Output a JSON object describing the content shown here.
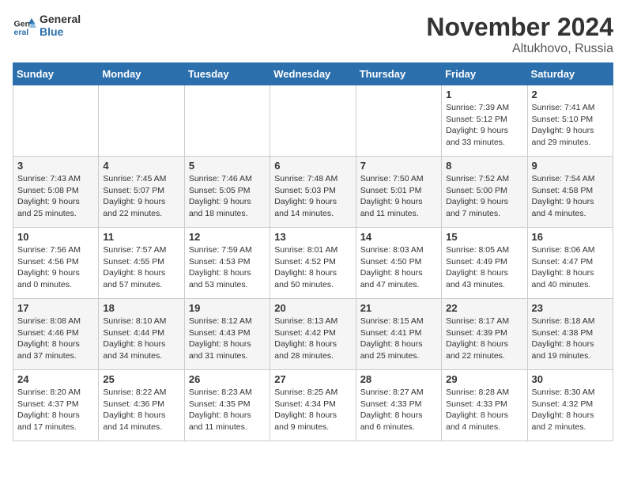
{
  "logo": {
    "line1": "General",
    "line2": "Blue"
  },
  "title": "November 2024",
  "location": "Altukhovo, Russia",
  "days_of_week": [
    "Sunday",
    "Monday",
    "Tuesday",
    "Wednesday",
    "Thursday",
    "Friday",
    "Saturday"
  ],
  "weeks": [
    [
      {
        "day": "",
        "info": ""
      },
      {
        "day": "",
        "info": ""
      },
      {
        "day": "",
        "info": ""
      },
      {
        "day": "",
        "info": ""
      },
      {
        "day": "",
        "info": ""
      },
      {
        "day": "1",
        "info": "Sunrise: 7:39 AM\nSunset: 5:12 PM\nDaylight: 9 hours and 33 minutes."
      },
      {
        "day": "2",
        "info": "Sunrise: 7:41 AM\nSunset: 5:10 PM\nDaylight: 9 hours and 29 minutes."
      }
    ],
    [
      {
        "day": "3",
        "info": "Sunrise: 7:43 AM\nSunset: 5:08 PM\nDaylight: 9 hours and 25 minutes."
      },
      {
        "day": "4",
        "info": "Sunrise: 7:45 AM\nSunset: 5:07 PM\nDaylight: 9 hours and 22 minutes."
      },
      {
        "day": "5",
        "info": "Sunrise: 7:46 AM\nSunset: 5:05 PM\nDaylight: 9 hours and 18 minutes."
      },
      {
        "day": "6",
        "info": "Sunrise: 7:48 AM\nSunset: 5:03 PM\nDaylight: 9 hours and 14 minutes."
      },
      {
        "day": "7",
        "info": "Sunrise: 7:50 AM\nSunset: 5:01 PM\nDaylight: 9 hours and 11 minutes."
      },
      {
        "day": "8",
        "info": "Sunrise: 7:52 AM\nSunset: 5:00 PM\nDaylight: 9 hours and 7 minutes."
      },
      {
        "day": "9",
        "info": "Sunrise: 7:54 AM\nSunset: 4:58 PM\nDaylight: 9 hours and 4 minutes."
      }
    ],
    [
      {
        "day": "10",
        "info": "Sunrise: 7:56 AM\nSunset: 4:56 PM\nDaylight: 9 hours and 0 minutes."
      },
      {
        "day": "11",
        "info": "Sunrise: 7:57 AM\nSunset: 4:55 PM\nDaylight: 8 hours and 57 minutes."
      },
      {
        "day": "12",
        "info": "Sunrise: 7:59 AM\nSunset: 4:53 PM\nDaylight: 8 hours and 53 minutes."
      },
      {
        "day": "13",
        "info": "Sunrise: 8:01 AM\nSunset: 4:52 PM\nDaylight: 8 hours and 50 minutes."
      },
      {
        "day": "14",
        "info": "Sunrise: 8:03 AM\nSunset: 4:50 PM\nDaylight: 8 hours and 47 minutes."
      },
      {
        "day": "15",
        "info": "Sunrise: 8:05 AM\nSunset: 4:49 PM\nDaylight: 8 hours and 43 minutes."
      },
      {
        "day": "16",
        "info": "Sunrise: 8:06 AM\nSunset: 4:47 PM\nDaylight: 8 hours and 40 minutes."
      }
    ],
    [
      {
        "day": "17",
        "info": "Sunrise: 8:08 AM\nSunset: 4:46 PM\nDaylight: 8 hours and 37 minutes."
      },
      {
        "day": "18",
        "info": "Sunrise: 8:10 AM\nSunset: 4:44 PM\nDaylight: 8 hours and 34 minutes."
      },
      {
        "day": "19",
        "info": "Sunrise: 8:12 AM\nSunset: 4:43 PM\nDaylight: 8 hours and 31 minutes."
      },
      {
        "day": "20",
        "info": "Sunrise: 8:13 AM\nSunset: 4:42 PM\nDaylight: 8 hours and 28 minutes."
      },
      {
        "day": "21",
        "info": "Sunrise: 8:15 AM\nSunset: 4:41 PM\nDaylight: 8 hours and 25 minutes."
      },
      {
        "day": "22",
        "info": "Sunrise: 8:17 AM\nSunset: 4:39 PM\nDaylight: 8 hours and 22 minutes."
      },
      {
        "day": "23",
        "info": "Sunrise: 8:18 AM\nSunset: 4:38 PM\nDaylight: 8 hours and 19 minutes."
      }
    ],
    [
      {
        "day": "24",
        "info": "Sunrise: 8:20 AM\nSunset: 4:37 PM\nDaylight: 8 hours and 17 minutes."
      },
      {
        "day": "25",
        "info": "Sunrise: 8:22 AM\nSunset: 4:36 PM\nDaylight: 8 hours and 14 minutes."
      },
      {
        "day": "26",
        "info": "Sunrise: 8:23 AM\nSunset: 4:35 PM\nDaylight: 8 hours and 11 minutes."
      },
      {
        "day": "27",
        "info": "Sunrise: 8:25 AM\nSunset: 4:34 PM\nDaylight: 8 hours and 9 minutes."
      },
      {
        "day": "28",
        "info": "Sunrise: 8:27 AM\nSunset: 4:33 PM\nDaylight: 8 hours and 6 minutes."
      },
      {
        "day": "29",
        "info": "Sunrise: 8:28 AM\nSunset: 4:33 PM\nDaylight: 8 hours and 4 minutes."
      },
      {
        "day": "30",
        "info": "Sunrise: 8:30 AM\nSunset: 4:32 PM\nDaylight: 8 hours and 2 minutes."
      }
    ]
  ]
}
